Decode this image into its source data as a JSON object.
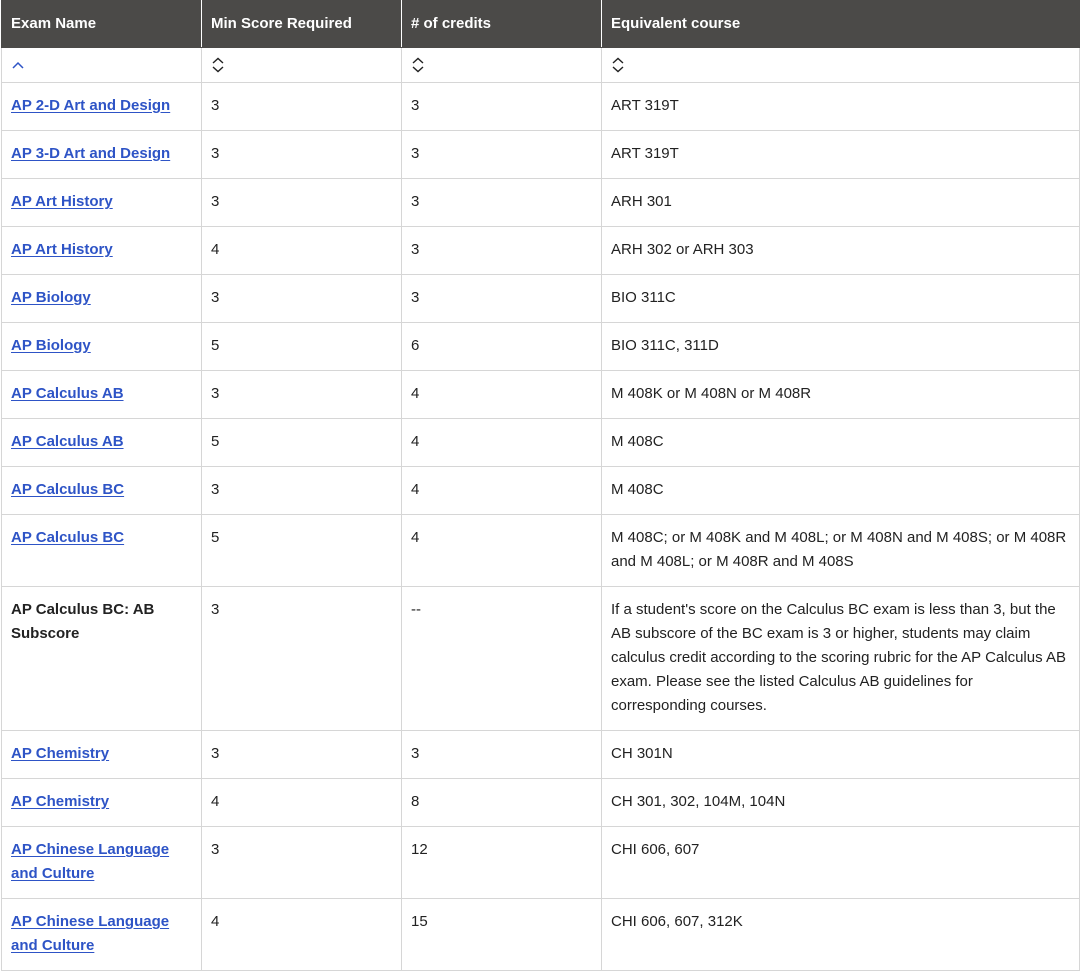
{
  "table": {
    "headers": [
      "Exam Name",
      "Min Score Required",
      "# of credits",
      "Equivalent course"
    ],
    "sort_icons": [
      "sort-ascending-icon",
      "sort-neutral-icon",
      "sort-neutral-icon",
      "sort-neutral-icon"
    ],
    "rows": [
      {
        "exam": "AP 2-D Art and Design",
        "link": true,
        "min_score": "3",
        "credits": "3",
        "course": "ART 319T"
      },
      {
        "exam": "AP 3-D Art and Design",
        "link": true,
        "min_score": "3",
        "credits": "3",
        "course": "ART 319T"
      },
      {
        "exam": "AP Art History",
        "link": true,
        "min_score": "3",
        "credits": "3",
        "course": "ARH 301"
      },
      {
        "exam": "AP Art History",
        "link": true,
        "min_score": "4",
        "credits": "3",
        "course": "ARH 302 or ARH 303"
      },
      {
        "exam": "AP Biology",
        "link": true,
        "min_score": "3",
        "credits": "3",
        "course": "BIO 311C"
      },
      {
        "exam": "AP Biology",
        "link": true,
        "min_score": "5",
        "credits": "6",
        "course": "BIO 311C, 311D"
      },
      {
        "exam": "AP Calculus AB",
        "link": true,
        "min_score": "3",
        "credits": "4",
        "course": "M 408K or M 408N or M 408R"
      },
      {
        "exam": "AP Calculus AB",
        "link": true,
        "min_score": "5",
        "credits": "4",
        "course": "M 408C"
      },
      {
        "exam": "AP Calculus BC",
        "link": true,
        "min_score": "3",
        "credits": "4",
        "course": "M 408C"
      },
      {
        "exam": "AP Calculus BC",
        "link": true,
        "min_score": "5",
        "credits": "4",
        "course": "M 408C; or M 408K and M 408L; or M 408N and M 408S; or M 408R and M 408L; or M 408R and M 408S"
      },
      {
        "exam": "AP Calculus BC: AB Subscore",
        "link": false,
        "min_score": "3",
        "credits": "--",
        "course": "If a student's score on the Calculus BC exam is less than 3, but the AB subscore of the BC exam is 3 or higher, students may claim calculus credit according to the scoring rubric for the AP Calculus AB exam. Please see the listed Calculus AB guidelines for corresponding courses."
      },
      {
        "exam": "AP Chemistry",
        "link": true,
        "min_score": "3",
        "credits": "3",
        "course": "CH 301N"
      },
      {
        "exam": "AP Chemistry",
        "link": true,
        "min_score": "4",
        "credits": "8",
        "course": "CH 301, 302, 104M, 104N"
      },
      {
        "exam": "AP Chinese Language and Culture",
        "link": true,
        "min_score": "3",
        "credits": "12",
        "course": "CHI 606, 607"
      },
      {
        "exam": "AP Chinese Language and Culture",
        "link": true,
        "min_score": "4",
        "credits": "15",
        "course": "CHI 606, 607, 312K"
      }
    ]
  },
  "colors": {
    "header_bg": "#4b4a48",
    "link": "#2e54c6",
    "border": "#d6d6d6"
  }
}
